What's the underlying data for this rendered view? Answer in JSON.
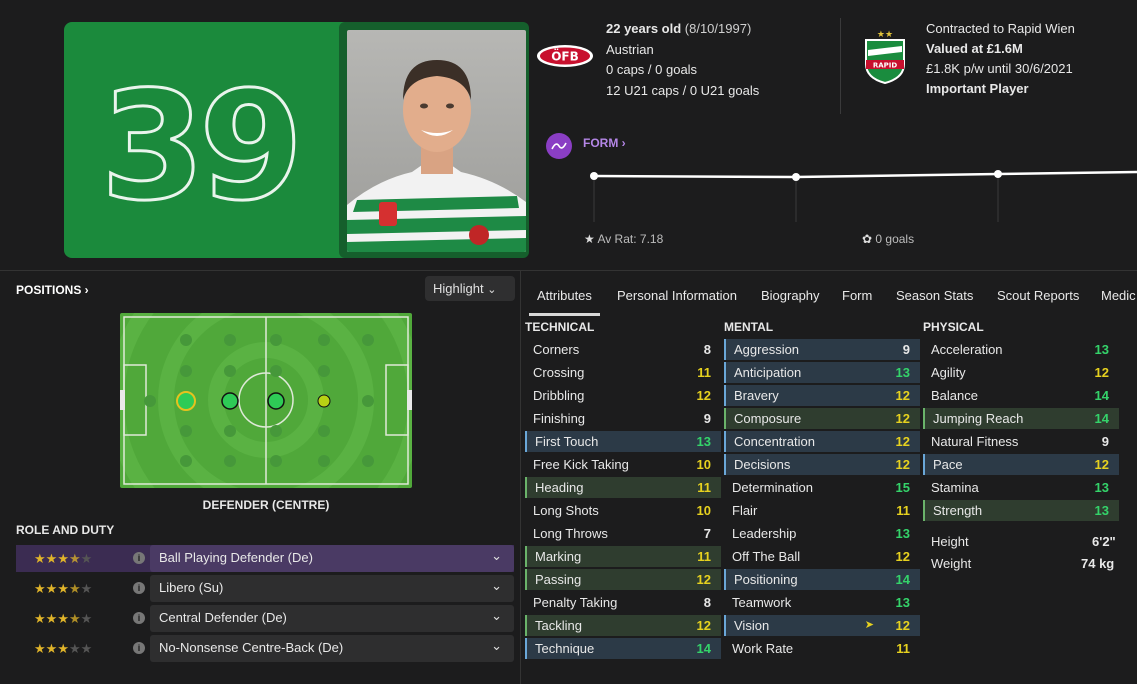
{
  "kit_number": "39",
  "player": {
    "age_line": "22 years old",
    "dob": "(8/10/1997)",
    "nationality": "Austrian",
    "caps": "0 caps / 0 goals",
    "u21_caps": "12 U21 caps / 0 U21 goals",
    "nation_badge": "ÖFB",
    "contract": "Contracted to Rapid Wien",
    "value": "Valued at £1.6M",
    "wage": "£1.8K p/w until 30/6/2021",
    "squad_status": "Important Player",
    "club_badge": "RAPID"
  },
  "form": {
    "label": "FORM ›",
    "av_rat": "Av Rat: 7.18",
    "goals": "0 goals"
  },
  "positions": {
    "label": "POSITIONS ›",
    "highlight": "Highlight",
    "position_name": "DEFENDER (CENTRE)"
  },
  "roles": {
    "label": "ROLE AND DUTY",
    "items": [
      {
        "stars": "★★★★★",
        "rating": 3.5,
        "name": "Ball Playing Defender (De)"
      },
      {
        "stars": "★★★★★",
        "rating": 3.5,
        "name": "Libero (Su)"
      },
      {
        "stars": "★★★★★",
        "rating": 3.5,
        "name": "Central Defender (De)"
      },
      {
        "stars": "★★★★★",
        "rating": 3,
        "name": "No-Nonsense Centre-Back (De)"
      }
    ]
  },
  "tabs": [
    "Attributes",
    "Personal Information",
    "Biography",
    "Form",
    "Season Stats",
    "Scout Reports",
    "Medic"
  ],
  "attributes": {
    "technical_label": "TECHNICAL",
    "mental_label": "MENTAL",
    "physical_label": "PHYSICAL",
    "technical": [
      {
        "name": "Corners",
        "value": "8"
      },
      {
        "name": "Crossing",
        "value": "11"
      },
      {
        "name": "Dribbling",
        "value": "12"
      },
      {
        "name": "Finishing",
        "value": "9"
      },
      {
        "name": "First Touch",
        "value": "13"
      },
      {
        "name": "Free Kick Taking",
        "value": "10"
      },
      {
        "name": "Heading",
        "value": "11"
      },
      {
        "name": "Long Shots",
        "value": "10"
      },
      {
        "name": "Long Throws",
        "value": "7"
      },
      {
        "name": "Marking",
        "value": "11"
      },
      {
        "name": "Passing",
        "value": "12"
      },
      {
        "name": "Penalty Taking",
        "value": "8"
      },
      {
        "name": "Tackling",
        "value": "12"
      },
      {
        "name": "Technique",
        "value": "14"
      }
    ],
    "mental": [
      {
        "name": "Aggression",
        "value": "9"
      },
      {
        "name": "Anticipation",
        "value": "13"
      },
      {
        "name": "Bravery",
        "value": "12"
      },
      {
        "name": "Composure",
        "value": "12"
      },
      {
        "name": "Concentration",
        "value": "12"
      },
      {
        "name": "Decisions",
        "value": "12"
      },
      {
        "name": "Determination",
        "value": "15"
      },
      {
        "name": "Flair",
        "value": "11"
      },
      {
        "name": "Leadership",
        "value": "13"
      },
      {
        "name": "Off The Ball",
        "value": "12"
      },
      {
        "name": "Positioning",
        "value": "14"
      },
      {
        "name": "Teamwork",
        "value": "13"
      },
      {
        "name": "Vision",
        "value": "12"
      },
      {
        "name": "Work Rate",
        "value": "11"
      }
    ],
    "physical": [
      {
        "name": "Acceleration",
        "value": "13"
      },
      {
        "name": "Agility",
        "value": "12"
      },
      {
        "name": "Balance",
        "value": "14"
      },
      {
        "name": "Jumping Reach",
        "value": "14"
      },
      {
        "name": "Natural Fitness",
        "value": "9"
      },
      {
        "name": "Pace",
        "value": "12"
      },
      {
        "name": "Stamina",
        "value": "13"
      },
      {
        "name": "Strength",
        "value": "13"
      }
    ],
    "height_label": "Height",
    "height": "6'2\"",
    "weight_label": "Weight",
    "weight": "74 kg"
  },
  "colors": {
    "kit": "#1b8a3c",
    "pitch": "#50a83a",
    "accent": "#8a3ec4",
    "high": "#34d36a",
    "mid": "#e6d11f"
  }
}
